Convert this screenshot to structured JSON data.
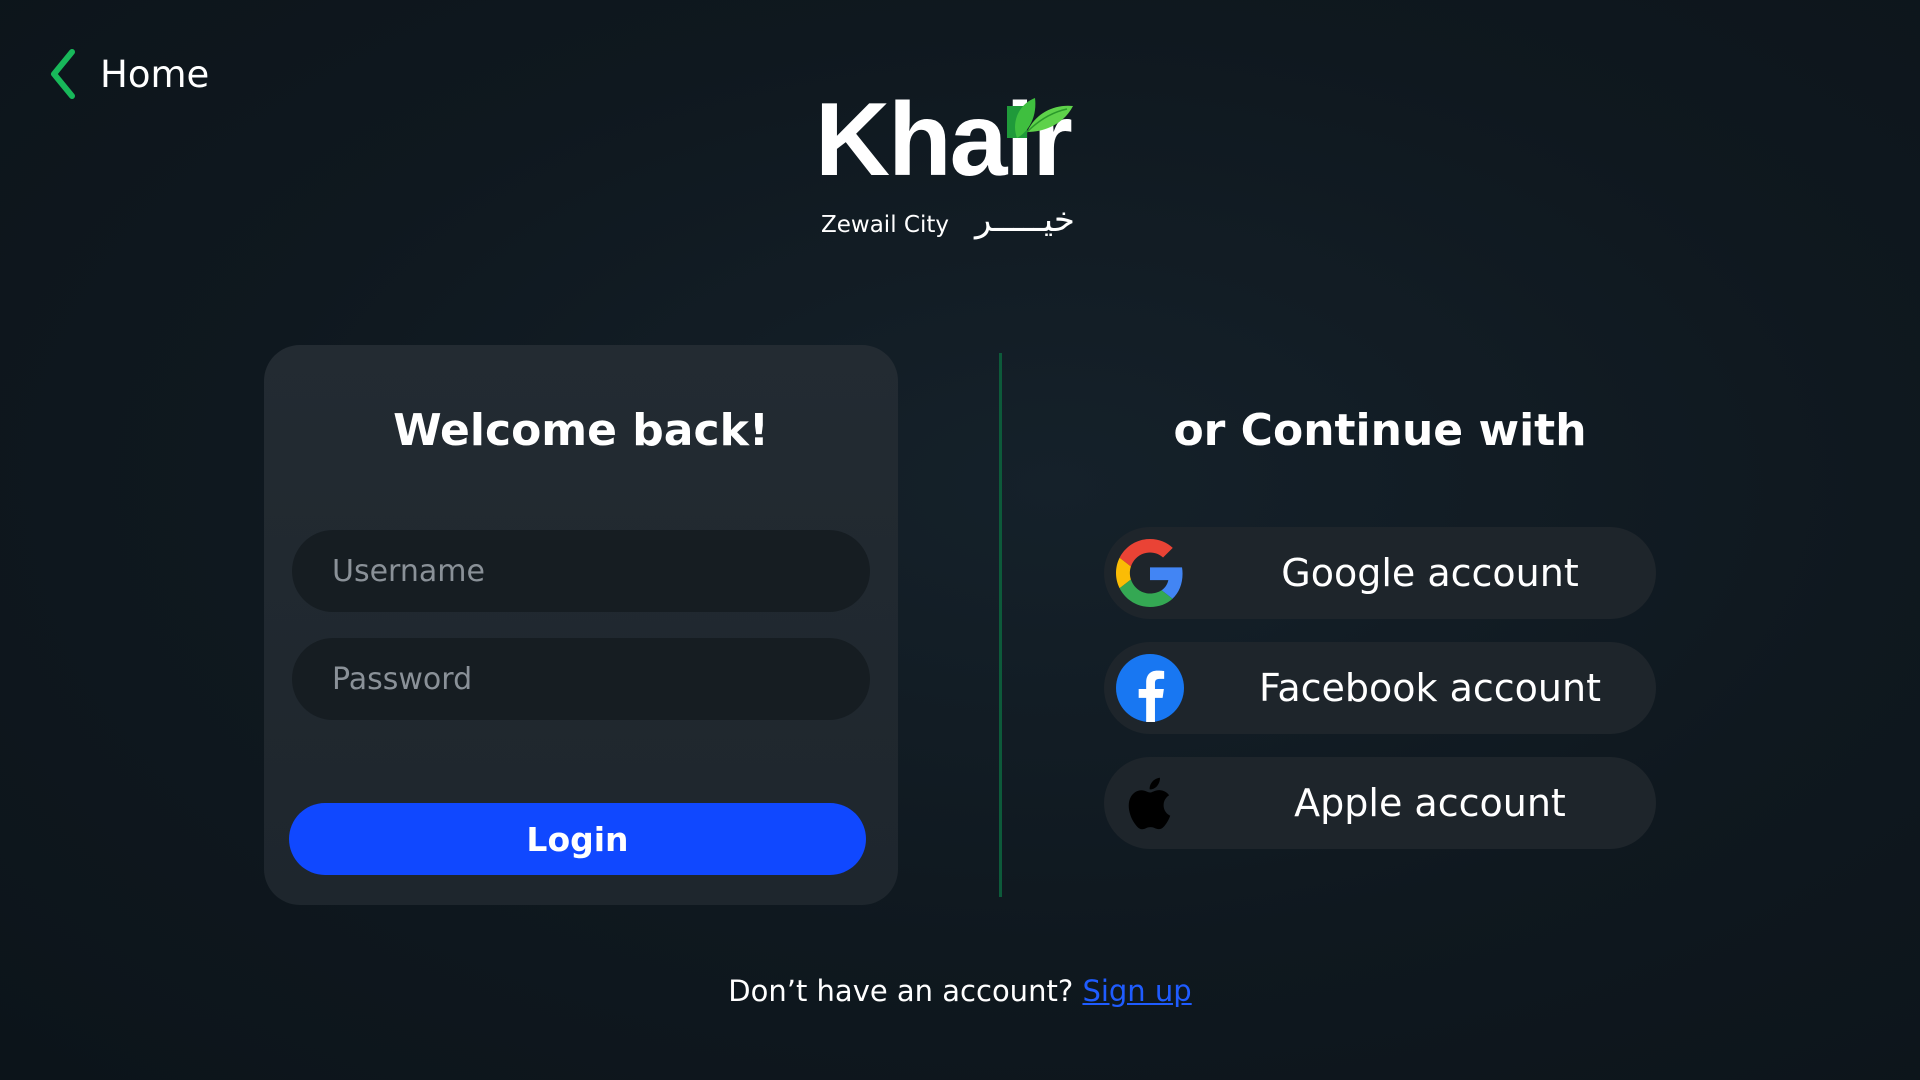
{
  "nav": {
    "back_label": "Home",
    "back_icon": "chevron-left-icon",
    "accent_color": "#18b85a"
  },
  "logo": {
    "wordmark": "Khair",
    "subtitle": "Zewail City",
    "arabic": "خيـــــر",
    "leaf_color": "#3fbf3f"
  },
  "login_card": {
    "title": "Welcome back!",
    "username_placeholder": "Username",
    "username_value": "",
    "password_placeholder": "Password",
    "password_value": "",
    "login_label": "Login",
    "login_color": "#1048ff"
  },
  "social": {
    "title": "or Continue with",
    "buttons": [
      {
        "label": "Google account",
        "icon": "google-icon"
      },
      {
        "label": "Facebook account",
        "icon": "facebook-icon"
      },
      {
        "label": "Apple account",
        "icon": "apple-icon"
      }
    ]
  },
  "footer": {
    "prompt": "Don’t have an account?",
    "signup_label": "Sign up",
    "signup_color": "#1f5cff"
  }
}
